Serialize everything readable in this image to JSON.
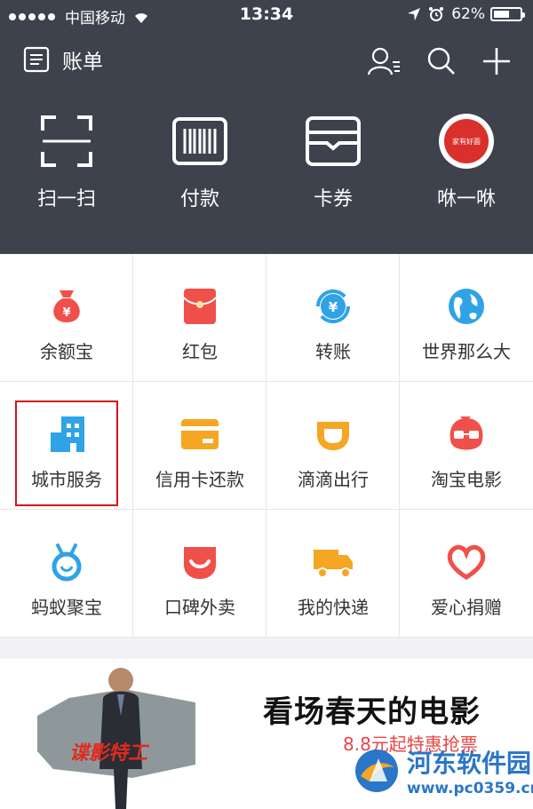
{
  "status_bar": {
    "carrier": "中国移动",
    "time": "13:34",
    "battery_text": "62%",
    "battery_level": 0.62
  },
  "header": {
    "bill_label": "账单",
    "icons": [
      "contacts-icon",
      "search-icon",
      "add-icon"
    ]
  },
  "quick_actions": [
    {
      "label": "扫一扫",
      "icon": "scan-icon"
    },
    {
      "label": "付款",
      "icon": "barcode-icon"
    },
    {
      "label": "卡券",
      "icon": "wallet-icon"
    },
    {
      "label": "咻一咻",
      "icon": "xiuxiu-icon",
      "badge_text": "家有好面"
    }
  ],
  "grid": [
    {
      "label": "余额宝",
      "icon": "money-bag-icon"
    },
    {
      "label": "红包",
      "icon": "red-envelope-icon"
    },
    {
      "label": "转账",
      "icon": "transfer-icon"
    },
    {
      "label": "世界那么大",
      "icon": "globe-icon"
    },
    {
      "label": "城市服务",
      "icon": "building-icon"
    },
    {
      "label": "信用卡还款",
      "icon": "credit-card-icon"
    },
    {
      "label": "滴滴出行",
      "icon": "didi-icon"
    },
    {
      "label": "淘宝电影",
      "icon": "movie-mascot-icon"
    },
    {
      "label": "蚂蚁聚宝",
      "icon": "ant-icon"
    },
    {
      "label": "口碑外卖",
      "icon": "koubei-icon"
    },
    {
      "label": "我的快递",
      "icon": "delivery-truck-icon"
    },
    {
      "label": "爱心捐赠",
      "icon": "heart-icon"
    }
  ],
  "banner": {
    "poster_title": "谍影特工",
    "headline": "看场春天的电影",
    "subtitle": "8.8元起特惠抢票"
  },
  "watermark": {
    "name": "河东软件园",
    "url": "www.pc0359.cn"
  },
  "colors": {
    "header_bg": "#3d424c",
    "red": "#f0504a",
    "blue": "#2fa3e6",
    "orange": "#f5a623",
    "highlight": "#d8141c"
  }
}
